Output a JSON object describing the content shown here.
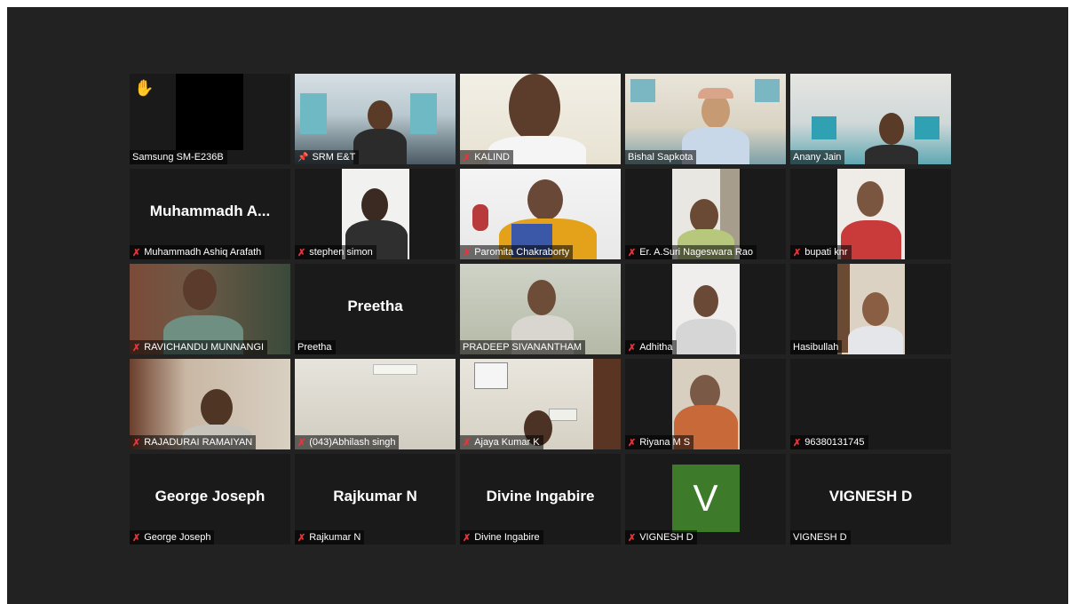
{
  "meeting": {
    "avatar_color": "#3d7a2a",
    "raise_hand_icon": "raised-hand-icon",
    "muted_icon": "mic-muted-icon",
    "pin_icon": "pin-icon",
    "participants": [
      {
        "name": "Samsung SM-E236B",
        "muted": false,
        "hand_raised": true,
        "type": "video-off-black"
      },
      {
        "name": "SRM E&T",
        "muted": false,
        "pinned": true,
        "active_speaker": true,
        "type": "video"
      },
      {
        "name": "KALIND",
        "muted": true,
        "type": "video"
      },
      {
        "name": "Bishal Sapkota",
        "muted": false,
        "type": "video"
      },
      {
        "name": "Anany Jain",
        "muted": false,
        "type": "video"
      },
      {
        "name": "Muhammadh Ashiq Arafath",
        "display": "Muhammadh A...",
        "muted": true,
        "type": "name-only"
      },
      {
        "name": "stephen simon",
        "muted": true,
        "type": "video"
      },
      {
        "name": "Paromita Chakraborty",
        "muted": true,
        "type": "video"
      },
      {
        "name": "Er. A.Suri Nageswara Rao",
        "muted": true,
        "type": "video"
      },
      {
        "name": "bupati knr",
        "muted": true,
        "type": "video"
      },
      {
        "name": "RAVICHANDU MUNNANGI",
        "muted": true,
        "type": "video"
      },
      {
        "name": "Preetha",
        "display": "Preetha",
        "muted": false,
        "type": "name-only"
      },
      {
        "name": "PRADEEP SIVANANTHAM",
        "muted": false,
        "type": "video"
      },
      {
        "name": "Adhitha",
        "muted": true,
        "type": "video"
      },
      {
        "name": "Hasibullah",
        "muted": false,
        "type": "video"
      },
      {
        "name": "RAJADURAI RAMAIYAN",
        "muted": true,
        "type": "video"
      },
      {
        "name": "(043)Abhilash singh",
        "muted": true,
        "type": "video"
      },
      {
        "name": "Ajaya Kumar K",
        "muted": true,
        "type": "video"
      },
      {
        "name": "Riyana M S",
        "muted": true,
        "type": "video"
      },
      {
        "name": "96380131745",
        "muted": true,
        "type": "blank"
      },
      {
        "name": "George Joseph",
        "display": "George Joseph",
        "muted": true,
        "type": "name-only"
      },
      {
        "name": "Rajkumar N",
        "display": "Rajkumar N",
        "muted": true,
        "type": "name-only"
      },
      {
        "name": "Divine Ingabire",
        "display": "Divine Ingabire",
        "muted": true,
        "type": "name-only"
      },
      {
        "name": "VIGNESH D",
        "initial": "V",
        "muted": true,
        "type": "avatar"
      },
      {
        "name": "VIGNESH D",
        "display": "VIGNESH D",
        "muted": false,
        "type": "name-only"
      }
    ]
  }
}
